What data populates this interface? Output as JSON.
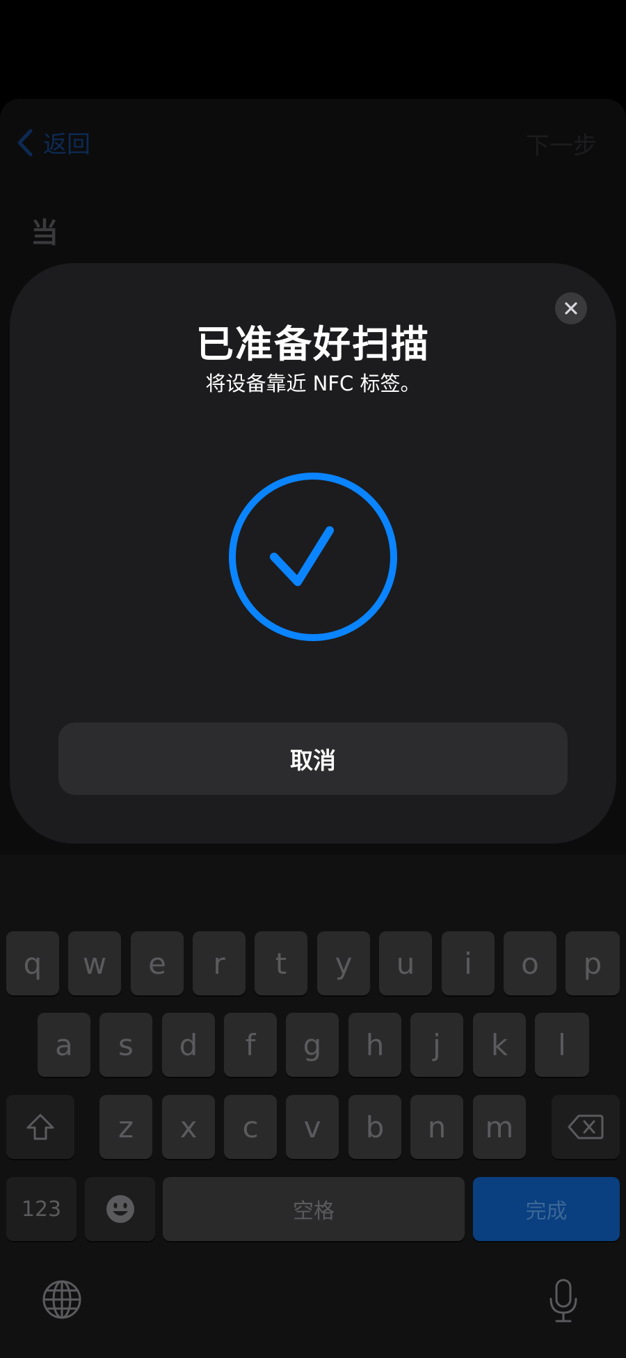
{
  "background_page": {
    "back_label": "返回",
    "next_label": "下一步",
    "heading": "当"
  },
  "nfc_sheet": {
    "title": "已准备好扫描",
    "subtitle": "将设备靠近 NFC 标签。",
    "status_icon": "checkmark-circle-icon",
    "cancel_label": "取消",
    "accent_color": "#0a84ff"
  },
  "keyboard": {
    "row1": [
      "q",
      "w",
      "e",
      "r",
      "t",
      "y",
      "u",
      "i",
      "o",
      "p"
    ],
    "row2": [
      "a",
      "s",
      "d",
      "f",
      "g",
      "h",
      "j",
      "k",
      "l"
    ],
    "row3": [
      "z",
      "x",
      "c",
      "v",
      "b",
      "n",
      "m"
    ],
    "numbers_label": "123",
    "space_label": "空格",
    "done_label": "完成",
    "icons": [
      "shift-icon",
      "delete-icon",
      "emoji-icon",
      "globe-icon",
      "microphone-icon"
    ]
  }
}
